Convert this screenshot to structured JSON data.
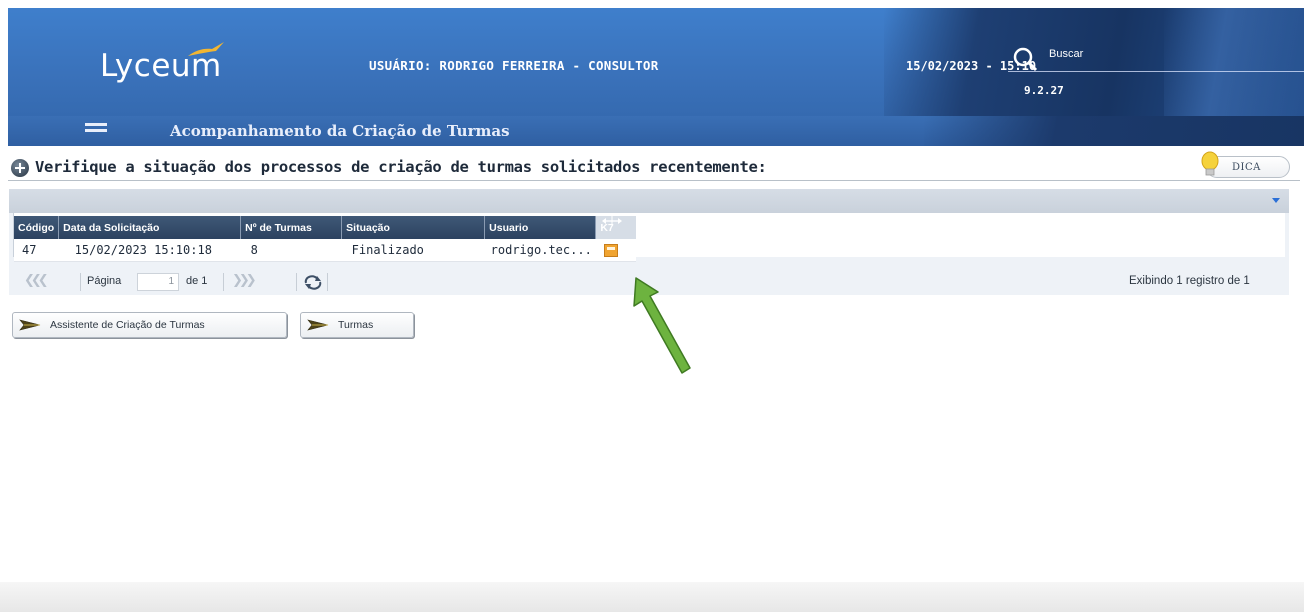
{
  "header": {
    "logo_text": "Lyceum",
    "user_label": "USUÁRIO: RODRIGO FERREIRA - CONSULTOR",
    "datetime": "15/02/2023 - 15:10",
    "version": "9.2.27",
    "search_label": "Buscar"
  },
  "nav": {
    "menu_icon": "hamburger-icon",
    "page_title": "Acompanhamento da Criação de Turmas"
  },
  "content": {
    "instruction": "Verifique a situação dos processos de criação de turmas solicitados recentemente:",
    "tip_label": "DICA"
  },
  "grid": {
    "columns": [
      "Código",
      "Data da Solicitação",
      "Nº de Turmas",
      "Situação",
      "Usuario"
    ],
    "expand_header": "K7",
    "rows": [
      {
        "codigo": "47",
        "data": "15/02/2023 15:10:18",
        "turmas": "8",
        "situacao": "Finalizado",
        "usuario": "rodrigo.tec..."
      }
    ]
  },
  "pager": {
    "page_label": "Página",
    "page_value": "1",
    "of_label": "de 1",
    "records_label": "Exibindo 1 registro de 1"
  },
  "buttons": {
    "assistant": "Assistente de Criação de Turmas",
    "turmas": "Turmas"
  },
  "colors": {
    "header_blue": "#3a72bb",
    "header_dark": "#173462",
    "grid_header": "#2c4260",
    "annotation_green": "#6db33f",
    "export_orange": "#f0a431"
  }
}
